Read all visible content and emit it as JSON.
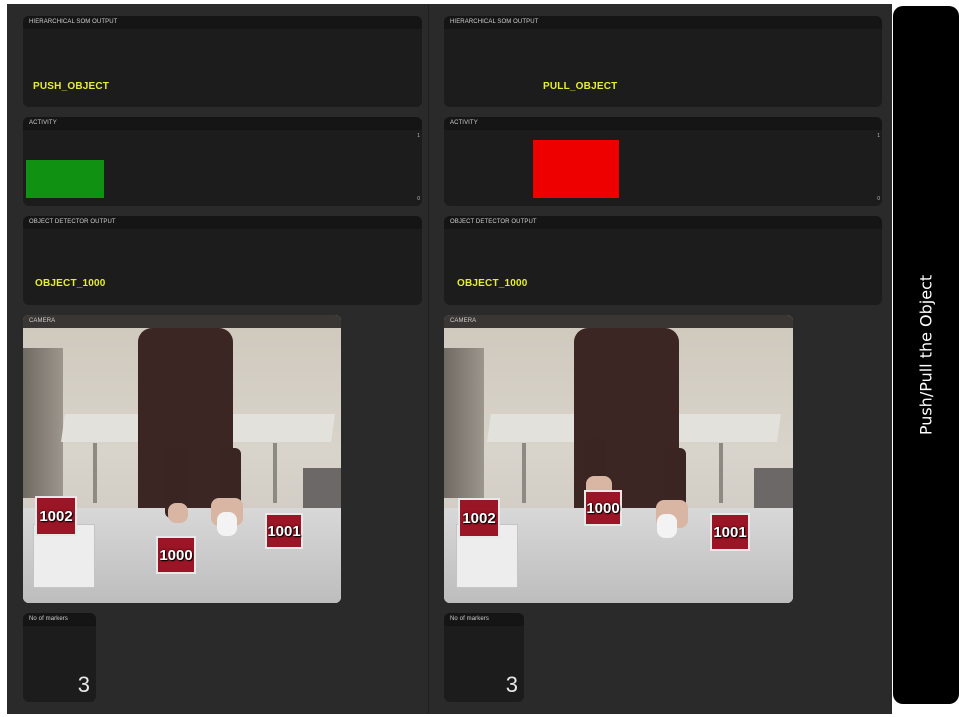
{
  "left": {
    "som": {
      "header": "HIERARCHICAL SOM OUTPUT",
      "value": "PUSH_OBJECT"
    },
    "activity": {
      "header": "ACTIVITY",
      "max": "1",
      "min": "0",
      "bar_color": "#119111",
      "bar_level": 0.62
    },
    "detector": {
      "header": "OBJECT DETECTOR OUTPUT",
      "value": "OBJECT_1000"
    },
    "camera": {
      "header": "CAMERA",
      "markers": [
        "1002",
        "1000",
        "1001"
      ]
    },
    "markers": {
      "header": "No of markers",
      "count": "3"
    }
  },
  "right": {
    "som": {
      "header": "HIERARCHICAL SOM OUTPUT",
      "value": "PULL_OBJECT"
    },
    "activity": {
      "header": "ACTIVITY",
      "max": "1",
      "min": "0",
      "bar_color": "#ee0000",
      "bar_level": 0.93
    },
    "detector": {
      "header": "OBJECT DETECTOR OUTPUT",
      "value": "OBJECT_1000"
    },
    "camera": {
      "header": "CAMERA",
      "markers": [
        "1002",
        "1000",
        "1001"
      ]
    },
    "markers": {
      "header": "No of markers",
      "count": "3"
    }
  },
  "side_title": "Push/Pull the Object"
}
